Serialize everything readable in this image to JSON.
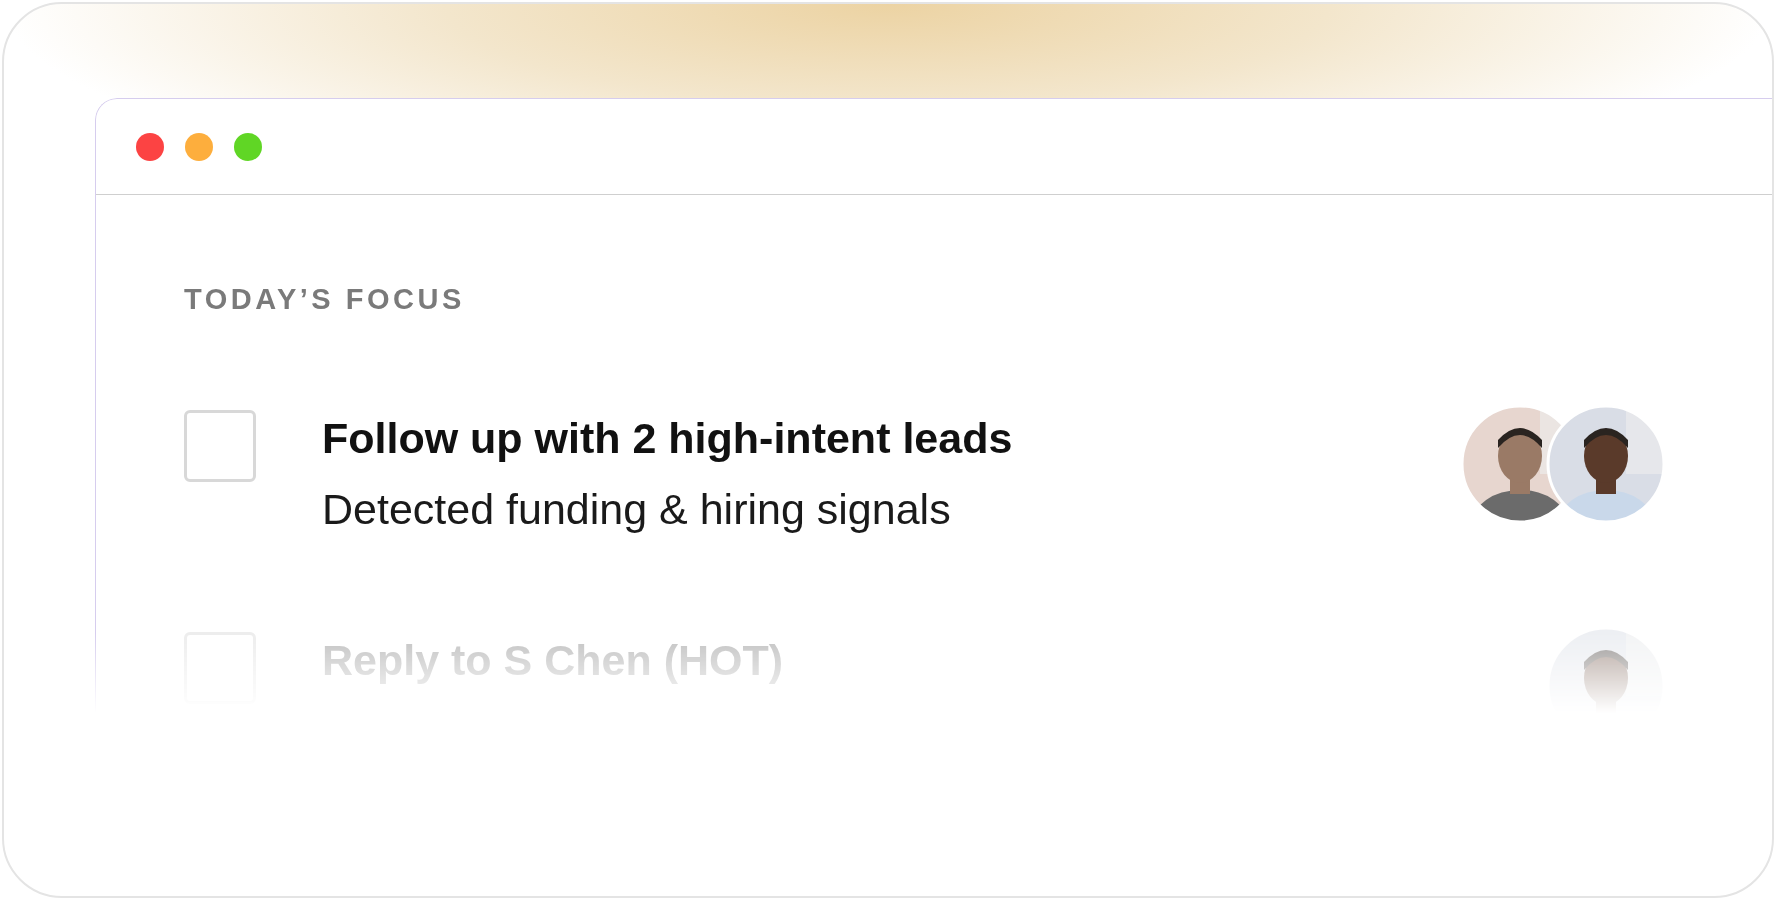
{
  "section": {
    "heading": "TODAY’S FOCUS"
  },
  "tasks": [
    {
      "title": "Follow up with 2 high-intent leads",
      "subtitle": "Detected funding & hiring signals",
      "checked": false,
      "faded": false
    },
    {
      "title": "Reply to S Chen (HOT)",
      "checked": false,
      "faded": true
    }
  ]
}
